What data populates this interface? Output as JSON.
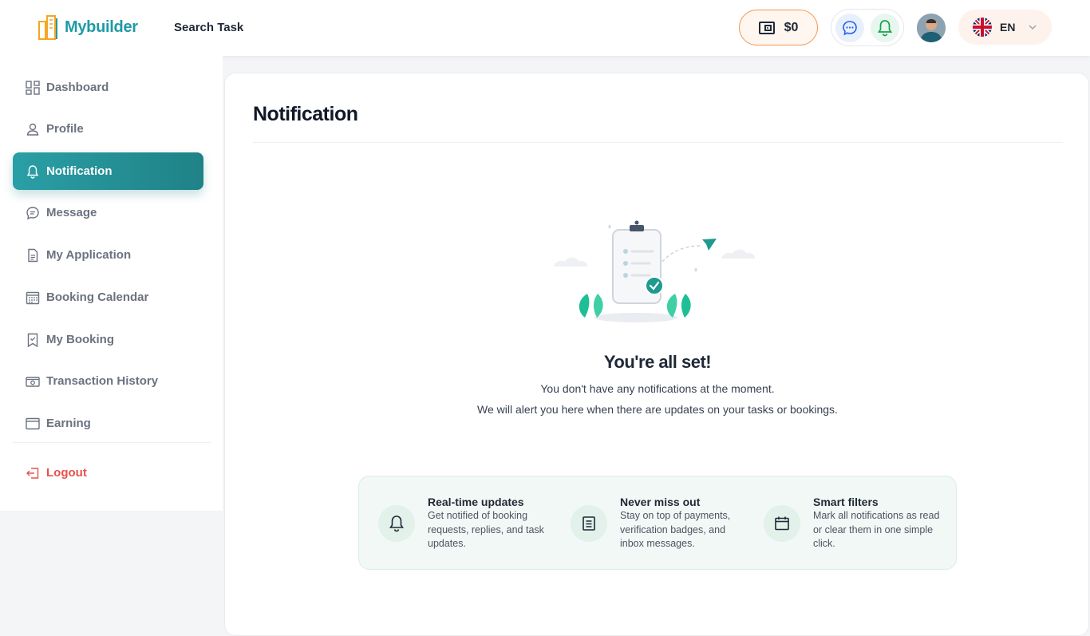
{
  "brand": {
    "name": "Mybuilder",
    "color": "#1f9aa6"
  },
  "header": {
    "search_task": "Search Task",
    "wallet_amount": "$0",
    "language": "EN"
  },
  "sidebar": {
    "items": [
      {
        "label": "Dashboard",
        "icon": "dashboard-icon"
      },
      {
        "label": "Profile",
        "icon": "user-icon"
      },
      {
        "label": "Notification",
        "icon": "bell-icon",
        "active": true
      },
      {
        "label": "Message",
        "icon": "chat-icon"
      },
      {
        "label": "My Application",
        "icon": "document-icon"
      },
      {
        "label": "Booking Calendar",
        "icon": "calendar-icon"
      },
      {
        "label": "My Booking",
        "icon": "bookmark-icon"
      },
      {
        "label": "Transaction History",
        "icon": "cash-icon"
      },
      {
        "label": "Earning",
        "icon": "card-icon"
      }
    ],
    "logout": "Logout"
  },
  "main": {
    "title": "Notification",
    "empty_title": "You're all set!",
    "empty_line1": "You don't have any notifications at the moment.",
    "empty_line2": "We will alert you here when there are updates on your tasks or bookings.",
    "features": [
      {
        "title": "Real-time updates",
        "desc": "Get notified of booking requests, replies, and task updates.",
        "icon": "bell-icon"
      },
      {
        "title": "Never miss out",
        "desc": "Stay on top of payments, verification badges, and inbox messages.",
        "icon": "list-icon"
      },
      {
        "title": "Smart filters",
        "desc": "Mark all notifications as read or clear them in one simple click.",
        "icon": "calendar-icon"
      }
    ]
  },
  "colors": {
    "accent": "#1f8286",
    "logout": "#e5534b",
    "wallet_border": "#f39b5b"
  }
}
